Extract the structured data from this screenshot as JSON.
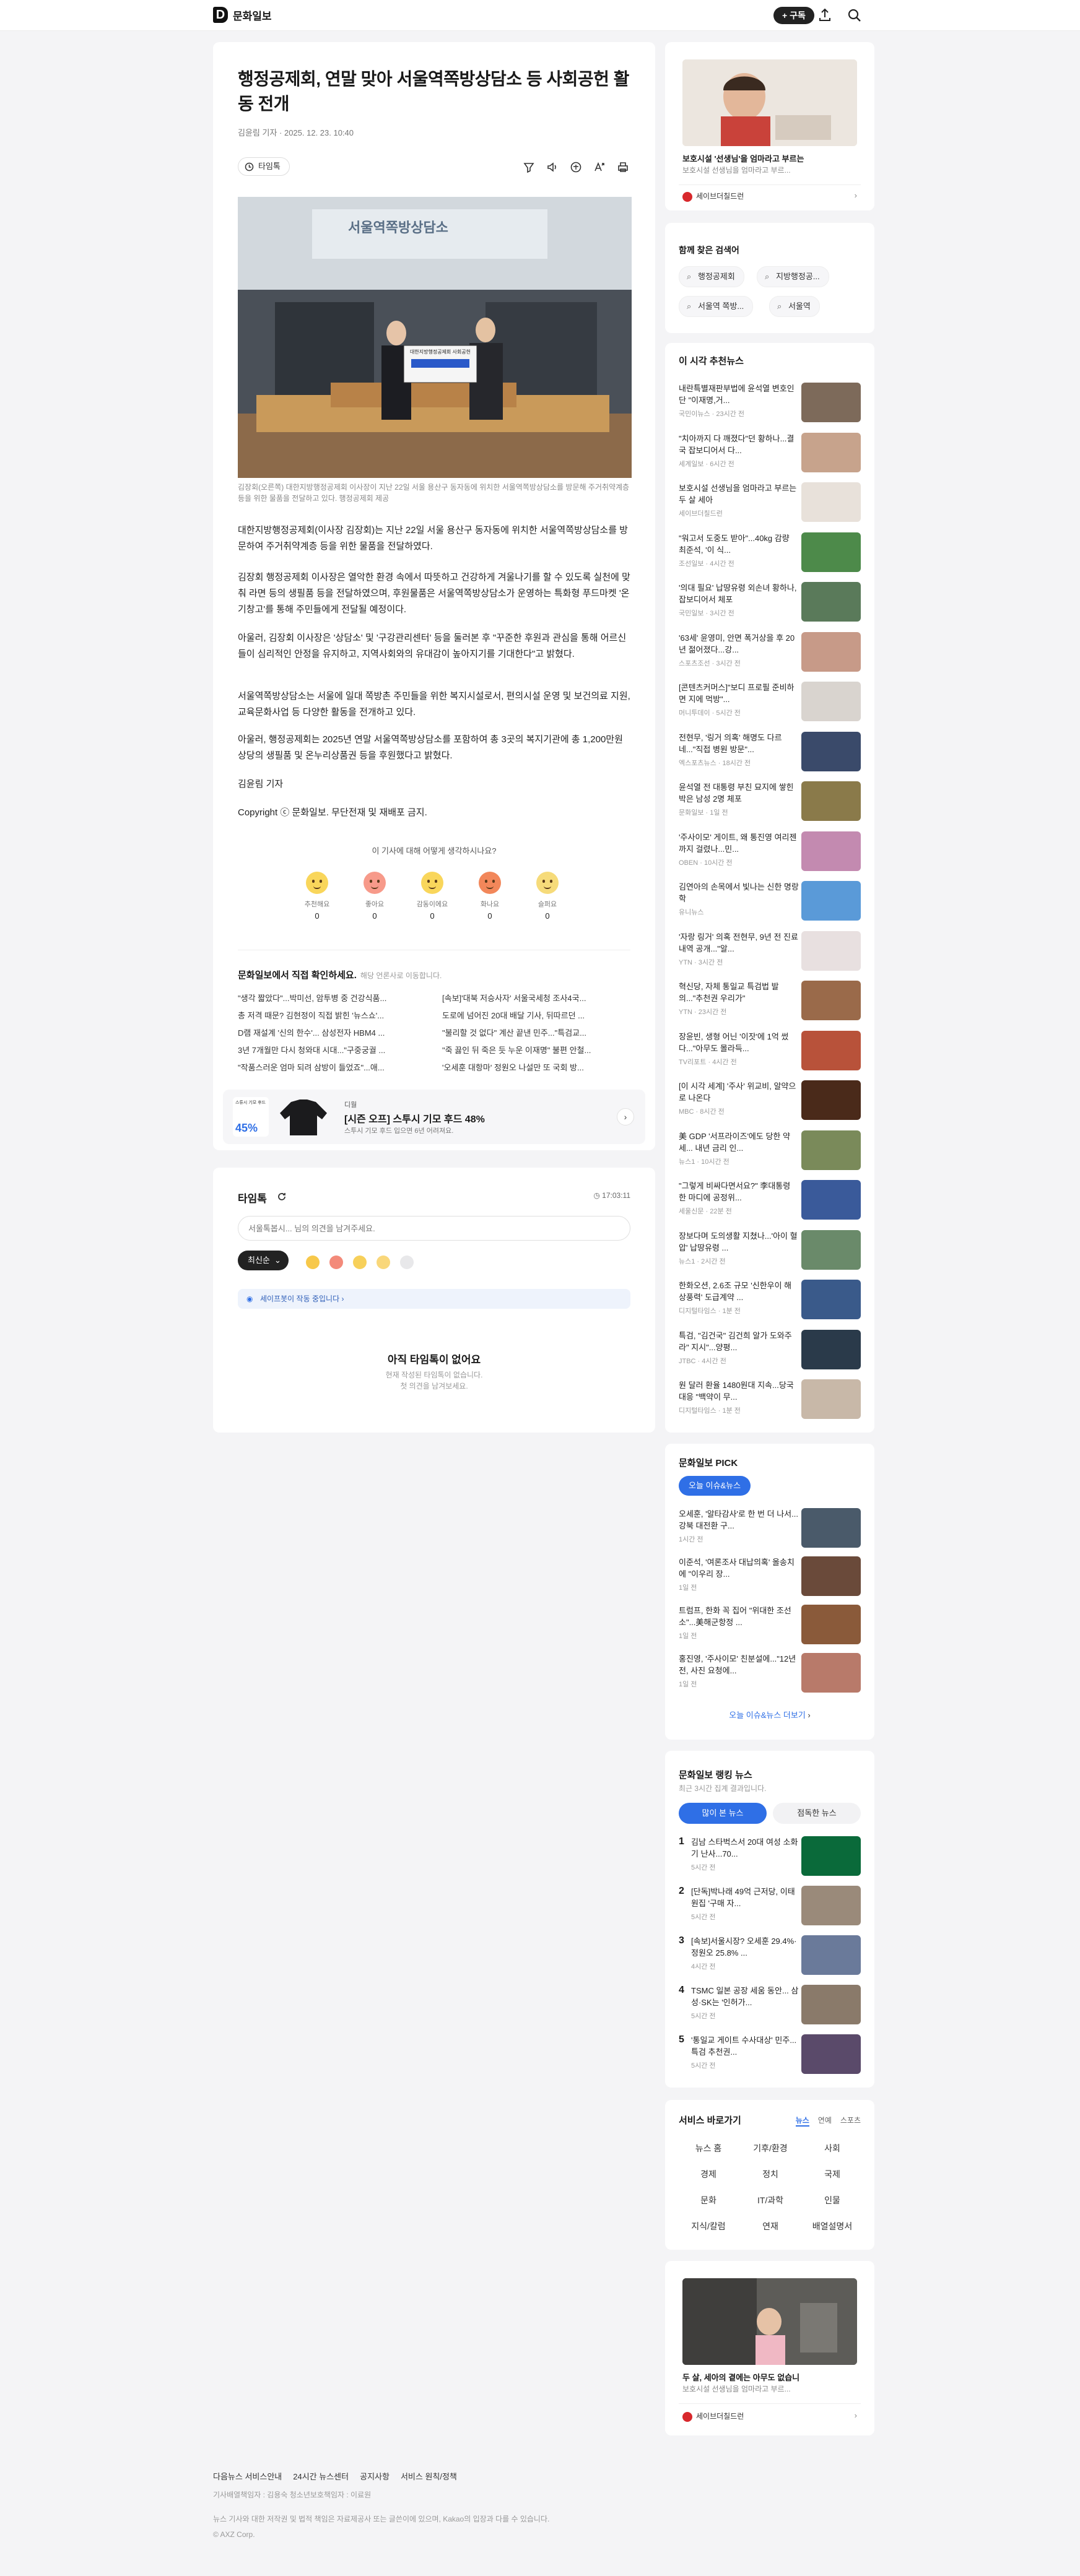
{
  "header": {
    "logo_letter": "D",
    "logo_text": "문화일보",
    "subscribe_label": "+ 구독"
  },
  "article": {
    "title": "행정공제회, 연말 맞아 서울역쪽방상담소 등 사회공헌 활동 전개",
    "byline": "김윤림 기자 · 2025. 12. 23. 10:40",
    "timeline_chip": "타임톡",
    "photo_sign": "서울역쪽방상담소",
    "photo_banner": "대한지방행정공제회 사회공헌",
    "caption": "김장회(오른쪽) 대한지방행정공제회 이사장이 지난 22일 서울 용산구 동자동에 위치한 서울역쪽방상담소를 방문해 주거취약계층 등을 위한 물품을 전달하고 있다. 행정공제회 제공",
    "paragraphs": [
      "대한지방행정공제회(이사장 김장회)는 지난 22일 서울 용산구 동자동에 위치한 서울역쪽방상담소를 방문하여 주거취약계층 등을 위한 물품을 전달하였다.",
      "김장회 행정공제회 이사장은 열악한 환경 속에서 따뜻하고 건강하게 겨울나기를 할 수 있도록 실천에 맞춰 라면 등의 생필품 등을 전달하였으며, 후원물품은 서울역쪽방상담소가 운영하는 특화형 푸드마켓 '온기창고'를 통해 주민들에게 전달될 예정이다.",
      "아울러, 김장회 이사장은 '상담소' 및 '구강관리센터' 등을 둘러본 후 \"꾸준한 후원과 관심을 통해 어르신들이 심리적인 안정을 유지하고, 지역사회와의 유대감이 높아지기를 기대한다\"고 밝혔다.",
      "서울역쪽방상담소는 서울에 일대 쪽방촌 주민들을 위한 복지시설로서, 편의시설 운영 및 보건의료 지원, 교육문화사업 등 다양한 활동을 전개하고 있다.",
      "아울러, 행정공제회는 2025년 연말 서울역쪽방상담소를 포함하여 총 3곳의 복지기관에 총 1,200만원 상당의 생필품 및 온누리상품권 등을 후원했다고 밝혔다.",
      "김윤림 기자",
      "Copyright ⓒ 문화일보. 무단전재 및 재배포 금지."
    ],
    "reaction_question": "이 기사에 대해 어떻게 생각하시나요?",
    "reactions": [
      {
        "label": "추천해요",
        "count": "0",
        "color": "#f9d65b"
      },
      {
        "label": "좋아요",
        "count": "0",
        "color": "#f79a8a"
      },
      {
        "label": "감동이에요",
        "count": "0",
        "color": "#f9d65b"
      },
      {
        "label": "화나요",
        "count": "0",
        "color": "#f2875a"
      },
      {
        "label": "슬퍼요",
        "count": "0",
        "color": "#f6db7a"
      }
    ],
    "related_title": "문화일보에서 직접 확인하세요.",
    "related_note": "해당 언론사로 이동합니다.",
    "related_left": [
      "\"생각 짧았다\"...박미선, 암투병 중 건강식품...",
      "총 저격 때문? 김현정이 직접 밝힌 '뉴스쇼'...",
      "D램 재설계 '신의 한수'... 삼성전자 HBM4 ...",
      "3년 7개월만 다시 청와대 시대...\"구중궁궐 ...",
      "\"작품스러운 엄마 되려 삼방이 들었죠\"...애..."
    ],
    "related_right": [
      "[속보]'대북 저승사자' 서울국세청 조사4국...",
      "도로에 넘어진 20대 배달 기사, 뒤따르던 ...",
      "\"불리할 것 없다\" 계산 끝낸 민주...\"특검교...",
      "\"죽 끓인 뒤 죽은 듯 누운 이재명\" 불편 안철...",
      "'오세훈 대항마' 정원오 나설만 또 국회 방..."
    ],
    "ad": {
      "brand": "디월",
      "badge": "스튜시 기모 후드",
      "discount": "45%",
      "headline": "[시즌 오프] 스투시 기모 후드 48%",
      "sub": "스투시 기모 후드 입으면 6년 어려져요."
    }
  },
  "timetalk": {
    "title": "타임톡",
    "time": "17:03:11",
    "placeholder": "서울톡봅시... 님의 의견을 남겨주세요.",
    "sort_label": "최신순",
    "banner": "세이프봇이 작동 중입니다",
    "empty_title": "아직 타임톡이 없어요",
    "empty_sub1": "현재 작성된 타임톡이 없습니다.",
    "empty_sub2": "첫 의견을 남겨보세요."
  },
  "side_ad1": {
    "title": "보호시설 '선생님'을 엄마라고 부르는",
    "sub": "보호시설 선생님을 엄마라고 부르...",
    "org": "세이브더칠드런"
  },
  "keywords": {
    "title": "함께 찾은 검색어",
    "items": [
      "행정공제회",
      "지방행정공...",
      "서울역 쪽방...",
      "서울역"
    ]
  },
  "recommend": {
    "title": "이 시각 추천뉴스",
    "items": [
      {
        "t": "내란특별재판부법에 윤석열 변호인단 \"이재명,거...",
        "m": "국민이뉴스 · 23시간 전",
        "c": "#7d6a5a"
      },
      {
        "t": "\"치아까지 다 깨졌다\"던 황하나...결국 잡보디어서 다...",
        "m": "세계일보 · 6시간 전",
        "c": "#c7a38c"
      },
      {
        "t": "보호시설 선생님을 엄마라고 부르는 두 살 세아",
        "m": "세이브더칠드런",
        "c": "#e8e1da"
      },
      {
        "t": "\"워고서 도중도 받아\"...40kg 감량 최준석, '이 식...",
        "m": "조선일보 · 4시간 전",
        "c": "#4d8a4a"
      },
      {
        "t": "'의대 필요' 납땅유령 외손녀 황하나, 잡보디어서 체포",
        "m": "국민일보 · 3시간 전",
        "c": "#5a7a5a"
      },
      {
        "t": "'63세' 윤영미, 안면 폭거상을 후 20년 젊어졌다...강...",
        "m": "스포츠조선 · 3시간 전",
        "c": "#c79a88"
      },
      {
        "t": "[콘텐츠커머스]\"보디 프로필 준비하면 지에 먹방\"...",
        "m": "머니투데이 · 5시간 전",
        "c": "#d9d4cf"
      },
      {
        "t": "전현무, '링거 의혹' 해명도 다르네...\"직접 병원 방문\"...",
        "m": "엑스포츠뉴스 · 18시간 전",
        "c": "#3a4a6a"
      },
      {
        "t": "윤석열 전 대통령 부친 묘지에 쌓힌 박은 남성 2명 체포",
        "m": "문화일보 · 1일 전",
        "c": "#8a7a4a"
      },
      {
        "t": "'주사이모' 게이트, 왜 통진영 여리젠까지 걸렸나...민...",
        "m": "OBEN · 10시간 전",
        "c": "#c38ab0"
      },
      {
        "t": "김연아의 손목에서 빛나는 신한 명랑학",
        "m": "유니뉴스",
        "c": "#5a9ad8"
      },
      {
        "t": "'자랑 링거' 의혹 전현무, 9년 전 진료 내역 공개...\"알...",
        "m": "YTN · 3시간 전",
        "c": "#e8e0e0"
      },
      {
        "t": "혁신당, 자체 통일교 특검법 발의...\"추천권 우리가\"",
        "m": "YTN · 23시간 전",
        "c": "#9a6a4a"
      },
      {
        "t": "장윤빈, 생형 어닌 '이잣'에 1억 썼다...\"아무도 몰라득...",
        "m": "TV리포트 · 4시간 전",
        "c": "#b8523a"
      },
      {
        "t": "[이 시각 세계] '주사' 위교비, 알약으로 나온다",
        "m": "MBC · 8시간 전",
        "c": "#4a2a1a"
      },
      {
        "t": "美 GDP '서프라이즈'에도 당한 약세... 내년 금리 인...",
        "m": "뉴스1 · 10시간 전",
        "c": "#7a8a5a"
      },
      {
        "t": "\"그렇게 비싸다면서요?\" 李대통령 한 마디에 공정위...",
        "m": "세울신문 · 22분 전",
        "c": "#3a5a9a"
      },
      {
        "t": "장보다며 도의생활 지쳤나...'아이 혈압' 납땅유령 ...",
        "m": "뉴스1 · 2시간 전",
        "c": "#6a8a6a"
      },
      {
        "t": "한화오션, 2.6조 규모 '신한우이 해상풍력' 도급계약 ...",
        "m": "디지털타임스 · 1분 전",
        "c": "#3a5a8a"
      },
      {
        "t": "특검, \"김건국\" 김건희 알가 도와주라\" 지시\"...양평...",
        "m": "JTBC · 4시간 전",
        "c": "#2a3a4a"
      },
      {
        "t": "원 달러 환율 1480원대 지속...당국 대응 \"백약이 무...",
        "m": "디지털타임스 · 1분 전",
        "c": "#c8b8a8"
      }
    ]
  },
  "pick": {
    "title": "문화일보 PICK",
    "pill": "오늘 이슈&뉴스",
    "items": [
      {
        "t": "오세훈, '알타감사'로 한 번 더 나서...강북 대전환 구...",
        "m": "1시간 전",
        "c": "#4a5a6a"
      },
      {
        "t": "이준석, '여론조사 대납의혹' 올송치에 \"이우리 장...",
        "m": "1일 전",
        "c": "#6a4a3a"
      },
      {
        "t": "트럼프, 한화 꼭 집어 \"위대한 조선소\"...美해군항정 ...",
        "m": "1일 전",
        "c": "#8a5a3a"
      },
      {
        "t": "홍진영, '주사이모' 친분설에...\"12년 전, 사진 요청에...",
        "m": "1일 전",
        "c": "#b87a6a"
      }
    ],
    "more": "오늘 이슈&뉴스 더보기"
  },
  "ranking": {
    "title": "문화일보 랭킹 뉴스",
    "sub": "최근 3시간 집계 결과입니다.",
    "tab1": "많이 본 뉴스",
    "tab2": "점독한 뉴스",
    "items": [
      {
        "n": "1",
        "t": "김남 스타벅스서 20대 여성 소화기 난사...70...",
        "m": "5시간 전",
        "c": "#0a6a3a"
      },
      {
        "n": "2",
        "t": "[단독]박나래 49억 근저당, 이태원집 '구매 자...",
        "m": "5시간 전",
        "c": "#9a8a7a"
      },
      {
        "n": "3",
        "t": "[속보]서울시장? 오세훈 29.4%·정원오 25.8% ...",
        "m": "4시간 전",
        "c": "#6a7a9a"
      },
      {
        "n": "4",
        "t": "TSMC 일본 공장 세움 동안... 삼성·SK는 '인허가...",
        "m": "5시간 전",
        "c": "#8a7a6a"
      },
      {
        "n": "5",
        "t": "'통일교 게이트 수사대상' 민주... 특검 추천권...",
        "m": "5시간 전",
        "c": "#5a4a6a"
      }
    ]
  },
  "services": {
    "title": "서비스 바로가기",
    "tabs": [
      "뉴스",
      "연예",
      "스포츠"
    ],
    "grid": [
      "뉴스 홈",
      "기후/환경",
      "사회",
      "경제",
      "정치",
      "국제",
      "문화",
      "IT/과학",
      "인물",
      "지식/칼럼",
      "연재",
      "배열설명서"
    ]
  },
  "side_ad2": {
    "title": "두 살, 세아의 곁에는 아무도 없습니",
    "sub": "보호시설 선생님을 엄마라고 부르...",
    "org": "세이브더칠드런"
  },
  "footer": {
    "links": [
      "다음뉴스 서비스안내",
      "24시간 뉴스센터",
      "공지사항",
      "서비스 원칙/정책"
    ],
    "line1": "기사배열책임자 : 김용숙    청소년보호책임자 : 이료원",
    "line2": "뉴스 기사와 대한 저작권 및 법적 책임은 자료제공사 또는 글쓴이에 있으며, Kakao의 입장과 다를 수 있습니다.",
    "copyright": "© AXZ Corp."
  },
  "colors": {
    "accent": "#2f6fe6",
    "dark": "#111111",
    "bg": "#f4f4f6"
  }
}
